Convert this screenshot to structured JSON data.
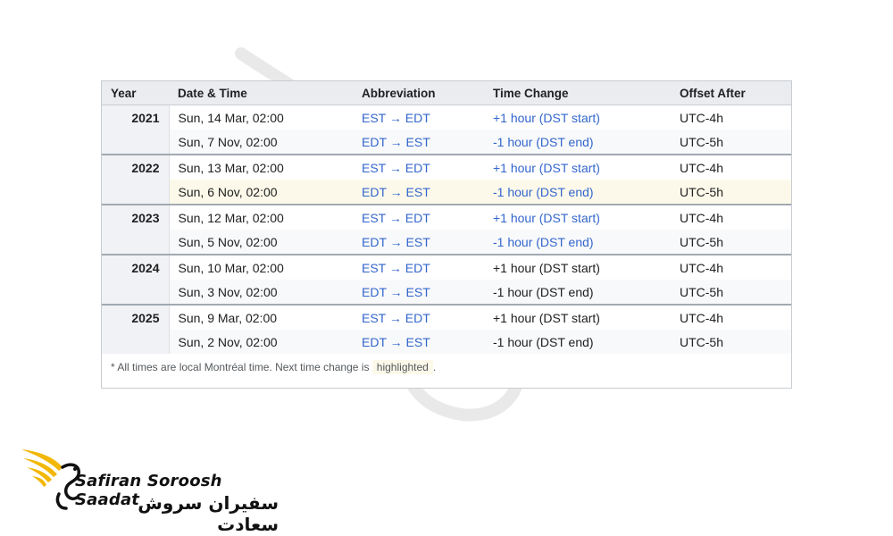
{
  "table": {
    "headers": [
      "Year",
      "Date & Time",
      "Abbreviation",
      "Time Change",
      "Offset After"
    ],
    "groups": [
      {
        "year": "2021",
        "rows": [
          {
            "date": "Sun, 14 Mar, 02:00",
            "abbr": "EST → EDT",
            "change": "+1 hour (DST start)",
            "offset": "UTC-4h"
          },
          {
            "date": "Sun, 7 Nov, 02:00",
            "abbr": "EDT → EST",
            "change": "-1 hour (DST end)",
            "offset": "UTC-5h"
          }
        ]
      },
      {
        "year": "2022",
        "rows": [
          {
            "date": "Sun, 13 Mar, 02:00",
            "abbr": "EST → EDT",
            "change": "+1 hour (DST start)",
            "offset": "UTC-4h"
          },
          {
            "date": "Sun, 6 Nov, 02:00",
            "abbr": "EDT → EST",
            "change": "-1 hour (DST end)",
            "offset": "UTC-5h",
            "highlighted": true
          }
        ]
      },
      {
        "year": "2023",
        "rows": [
          {
            "date": "Sun, 12 Mar, 02:00",
            "abbr": "EST → EDT",
            "change": "+1 hour (DST start)",
            "offset": "UTC-4h"
          },
          {
            "date": "Sun, 5 Nov, 02:00",
            "abbr": "EDT → EST",
            "change": "-1 hour (DST end)",
            "offset": "UTC-5h"
          }
        ]
      },
      {
        "year": "2024",
        "rows": [
          {
            "date": "Sun, 10 Mar, 02:00",
            "abbr": "EST → EDT",
            "change": "+1 hour (DST start)",
            "offset": "UTC-4h"
          },
          {
            "date": "Sun, 3 Nov, 02:00",
            "abbr": "EDT → EST",
            "change": "-1 hour (DST end)",
            "offset": "UTC-5h"
          }
        ]
      },
      {
        "year": "2025",
        "rows": [
          {
            "date": "Sun, 9 Mar, 02:00",
            "abbr": "EST → EDT",
            "change": "+1 hour (DST start)",
            "offset": "UTC-4h"
          },
          {
            "date": "Sun, 2 Nov, 02:00",
            "abbr": "EDT → EST",
            "change": "-1 hour (DST end)",
            "offset": "UTC-5h"
          }
        ]
      }
    ],
    "footnote": {
      "prefix": "* All times are local Montréal time. Next time change is",
      "highlight": "highlighted",
      "suffix": "."
    }
  },
  "colors": {
    "link": "#3366cc",
    "highlight_row": "#fdf9ea",
    "header_bg": "#eaecf0",
    "logo_gold": "#f2b707"
  },
  "logo": {
    "name_en": "Safiran Soroosh Saadat",
    "name_fa": "سفیران سروش سعادت",
    "icons": [
      "phoenix-wings-icon",
      "bird-watermark-icon"
    ]
  }
}
